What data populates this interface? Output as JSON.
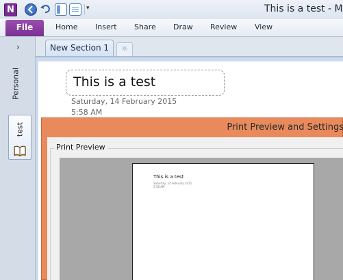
{
  "titlebar": {
    "app_letter": "N",
    "window_title": "This is a test - Mi",
    "customize_glyph": "▾"
  },
  "ribbon": {
    "file": "File",
    "tabs": [
      "Home",
      "Insert",
      "Share",
      "Draw",
      "Review",
      "View"
    ]
  },
  "notebooks": {
    "expand_glyph": "›",
    "personal": "Personal",
    "test": "test"
  },
  "sections": {
    "active": "New Section 1",
    "new_glyph": "☼"
  },
  "page": {
    "title": "This is a test",
    "date": "Saturday, 14 February 2015",
    "time": "5:58 AM"
  },
  "dialog": {
    "title": "Print Preview and Settings",
    "group_label": "Print Preview",
    "sheet_title": "This is a test",
    "sheet_date": "Saturday, 14 February 2015",
    "sheet_time": "5:58 AM"
  },
  "colors": {
    "file_tab": "#7a2f93",
    "dialog_header": "#e88a5c"
  }
}
